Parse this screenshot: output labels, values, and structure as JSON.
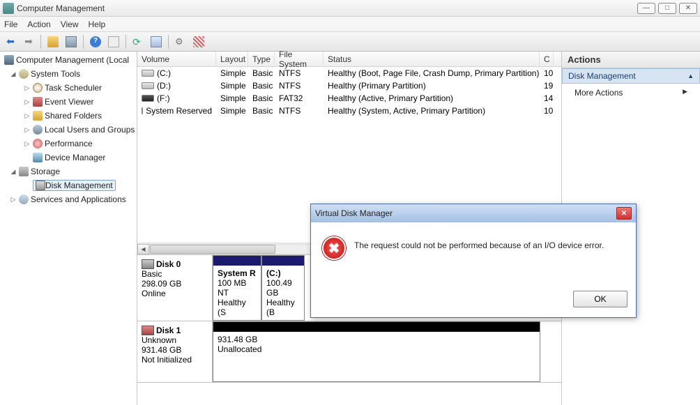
{
  "window": {
    "title": "Computer Management"
  },
  "menu": {
    "file": "File",
    "action": "Action",
    "view": "View",
    "help": "Help"
  },
  "tree": {
    "root": "Computer Management (Local",
    "system_tools": "System Tools",
    "task_scheduler": "Task Scheduler",
    "event_viewer": "Event Viewer",
    "shared_folders": "Shared Folders",
    "local_users": "Local Users and Groups",
    "performance": "Performance",
    "device_manager": "Device Manager",
    "storage": "Storage",
    "disk_management": "Disk Management",
    "services": "Services and Applications"
  },
  "vol_cols": {
    "volume": "Volume",
    "layout": "Layout",
    "type": "Type",
    "fs": "File System",
    "status": "Status",
    "cap": "C"
  },
  "volumes": [
    {
      "name": "(C:)",
      "dark": false,
      "layout": "Simple",
      "type": "Basic",
      "fs": "NTFS",
      "status": "Healthy (Boot, Page File, Crash Dump, Primary Partition)",
      "cap": "10"
    },
    {
      "name": "(D:)",
      "dark": false,
      "layout": "Simple",
      "type": "Basic",
      "fs": "NTFS",
      "status": "Healthy (Primary Partition)",
      "cap": "19"
    },
    {
      "name": "(F:)",
      "dark": true,
      "layout": "Simple",
      "type": "Basic",
      "fs": "FAT32",
      "status": "Healthy (Active, Primary Partition)",
      "cap": "14"
    },
    {
      "name": "System Reserved",
      "dark": false,
      "layout": "Simple",
      "type": "Basic",
      "fs": "NTFS",
      "status": "Healthy (System, Active, Primary Partition)",
      "cap": "10"
    }
  ],
  "disks": {
    "d0": {
      "name": "Disk 0",
      "type": "Basic",
      "size": "298.09 GB",
      "state": "Online",
      "p0": {
        "name": "System R",
        "size": "100 MB NT",
        "status": "Healthy (S"
      },
      "p1": {
        "name": "(C:)",
        "size": "100.49 GB",
        "status": "Healthy (B"
      }
    },
    "d1": {
      "name": "Disk 1",
      "type": "Unknown",
      "size": "931.48 GB",
      "state": "Not Initialized",
      "p0": {
        "size": "931.48 GB",
        "status": "Unallocated"
      }
    }
  },
  "actions": {
    "header": "Actions",
    "section": "Disk Management",
    "more": "More Actions"
  },
  "dialog": {
    "title": "Virtual Disk Manager",
    "message": "The request could not be performed because of an I/O device error.",
    "ok": "OK"
  }
}
